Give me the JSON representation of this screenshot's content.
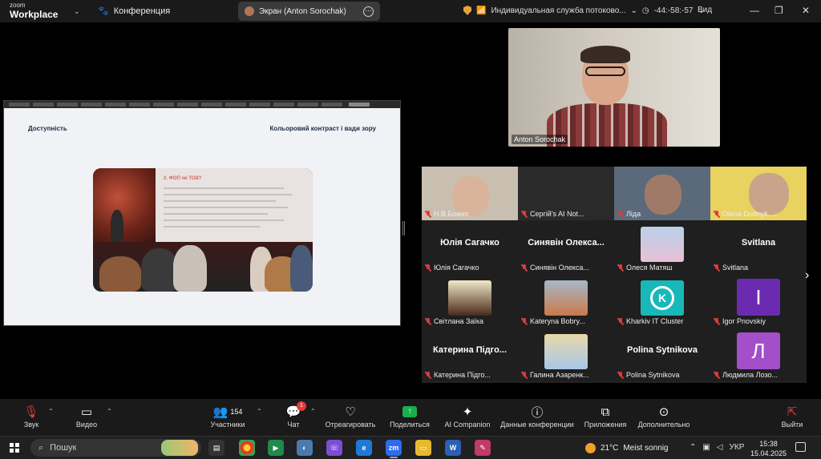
{
  "app": {
    "logo_line1": "zoom",
    "logo_line2": "Workplace",
    "meeting_label": "Конференция",
    "screen_pill": "Экран (Anton Sorochak)",
    "stream_label": "Индивидуальная служба потоково...",
    "timer": "-44:-58:-57",
    "view_label": "Вид"
  },
  "slide": {
    "left_title": "Доступність",
    "right_title": "Кольоровий контраст і вади зору",
    "projector_title": "2. ФОП чи ТОВ?"
  },
  "speaker": {
    "name": "Anton Sorochak"
  },
  "participants": [
    {
      "name": "Н.В.Божко",
      "type": "video",
      "muted": true
    },
    {
      "name": "Сергій's AI Not...",
      "type": "video",
      "muted": true
    },
    {
      "name": "Ліда",
      "type": "video",
      "muted": true
    },
    {
      "name": "Olena Dudnyk, ...",
      "type": "video",
      "muted": true
    },
    {
      "name": "Юлія Сагачко",
      "big": "Юлія Сагачко",
      "type": "name",
      "muted": true
    },
    {
      "name": "Синявін Олекса...",
      "big": "Синявін Олекса...",
      "type": "name",
      "muted": true
    },
    {
      "name": "Олеся Матяш",
      "type": "photo",
      "muted": true
    },
    {
      "name": "Svitlana",
      "big": "Svitlana",
      "type": "name",
      "muted": true
    },
    {
      "name": "Світлана Заїка",
      "type": "photo",
      "muted": true
    },
    {
      "name": "Kateryna Bobry...",
      "type": "photo",
      "muted": true
    },
    {
      "name": "Kharkiv IT Cluster",
      "type": "logo",
      "muted": true
    },
    {
      "name": "Igor Pnovskiy",
      "initial": "I",
      "type": "initial",
      "color": "#6a2bb0",
      "muted": true
    },
    {
      "name": "Катерина Підго...",
      "big": "Катерина Підго...",
      "type": "name",
      "muted": true
    },
    {
      "name": "Галина Азаренк...",
      "type": "photo",
      "muted": true
    },
    {
      "name": "Polina Sytnikova",
      "big": "Polina Sytnikova",
      "type": "name",
      "muted": true
    },
    {
      "name": "Людмила Лозо...",
      "initial": "Л",
      "type": "initial",
      "color": "#a34fc9",
      "muted": true
    }
  ],
  "toolbar": {
    "audio": "Звук",
    "video": "Видео",
    "participants": "Участники",
    "participants_count": "154",
    "chat": "Чат",
    "chat_badge": "1",
    "react": "Отреагировать",
    "share": "Поделиться",
    "ai": "AI Companion",
    "info": "Данные конференции",
    "apps": "Приложения",
    "more": "Дополнительно",
    "leave": "Выйти"
  },
  "taskbar": {
    "search_placeholder": "Пошук",
    "temperature": "21°C",
    "weather_text": "Meist sonnig",
    "language": "УКР",
    "time": "15:38",
    "date": "15.04.2025"
  },
  "colors": {
    "zoom_bg": "#000000",
    "toolbar_bg": "#1a1a1a",
    "mute_red": "#e03a3a",
    "share_green": "#19b04b"
  }
}
